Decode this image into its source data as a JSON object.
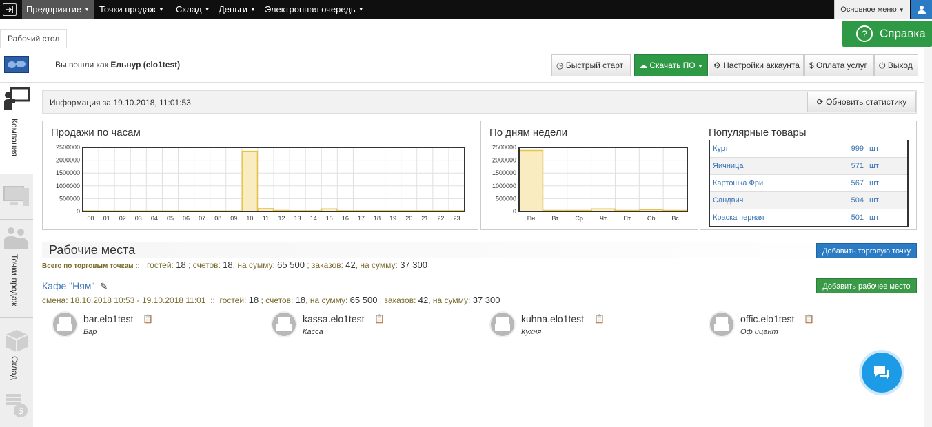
{
  "topnav": {
    "items": [
      {
        "label": "Предприятие"
      },
      {
        "label": "Точки продаж"
      },
      {
        "label": "Склад"
      },
      {
        "label": "Деньги"
      },
      {
        "label": "Электронная очередь"
      }
    ],
    "main_menu": "Основное меню"
  },
  "tabs": {
    "desk": "Рабочий стол"
  },
  "help": {
    "label": "Справка"
  },
  "header": {
    "logged_prefix": "Вы вошли как",
    "user": "Ельнур (elo1test)",
    "buttons": {
      "quickstart": "Быстрый старт",
      "download": "Скачать ПО",
      "settings": "Настройки аккаунта",
      "payment": "Оплата услуг",
      "exit": "Выход"
    }
  },
  "sidebar": {
    "items": [
      "Компания",
      "",
      "Точки продаж",
      "Склад",
      ""
    ]
  },
  "info": {
    "text": "Информация за 19.10.2018, 11:01:53",
    "refresh": "Обновить статистику"
  },
  "colors": {
    "bar_fill": "#f9ecc0",
    "bar_stroke": "#e8c24a",
    "accent_blue": "#2a7bc3",
    "accent_green": "#2e9a45"
  },
  "chart_data": [
    {
      "type": "bar",
      "title": "Продажи по часам",
      "categories": [
        "00",
        "01",
        "02",
        "03",
        "04",
        "05",
        "06",
        "07",
        "08",
        "09",
        "10",
        "11",
        "12",
        "13",
        "14",
        "15",
        "16",
        "17",
        "18",
        "19",
        "20",
        "21",
        "22",
        "23"
      ],
      "values": [
        25000,
        20000,
        20000,
        20000,
        20000,
        20000,
        20000,
        20000,
        20000,
        20000,
        2350000,
        110000,
        40000,
        30000,
        30000,
        100000,
        30000,
        30000,
        30000,
        30000,
        30000,
        30000,
        30000,
        30000
      ],
      "ylim": [
        0,
        2500000
      ],
      "yticks": [
        "2500000",
        "2000000",
        "1500000",
        "1000000",
        "500000",
        "0"
      ]
    },
    {
      "type": "bar",
      "title": "По дням недели",
      "categories": [
        "Пн",
        "Вт",
        "Ср",
        "Чт",
        "Пт",
        "Сб",
        "Вс"
      ],
      "values": [
        2380000,
        40000,
        40000,
        100000,
        40000,
        70000,
        40000
      ],
      "ylim": [
        0,
        2500000
      ],
      "yticks": [
        "2500000",
        "2000000",
        "1500000",
        "1000000",
        "500000",
        "0"
      ]
    }
  ],
  "popular": {
    "title": "Популярные товары",
    "rows": [
      {
        "name": "Курт",
        "qty": "999",
        "unit": "шт"
      },
      {
        "name": "Яичница",
        "qty": "571",
        "unit": "шт"
      },
      {
        "name": "Картошка Фри",
        "qty": "567",
        "unit": "шт"
      },
      {
        "name": "Сандвич",
        "qty": "504",
        "unit": "шт"
      },
      {
        "name": "Краска черная",
        "qty": "501",
        "unit": "шт"
      }
    ]
  },
  "workplaces": {
    "title": "Рабочие места",
    "add_point": "Добавить торговую точку",
    "totals_label": "Всего по торговым точкам ::",
    "guests_label": "гостей:",
    "guests": "18",
    "checks_label": "; счетов:",
    "checks": "18",
    "sum_label": ", на сумму:",
    "sum": "65 500",
    "orders_label": "; заказов:",
    "orders": "42",
    "orders_sum_label": ", на сумму:",
    "orders_sum": "37 300",
    "cafe": "Кафе \"Ням\"",
    "add_workplace": "Добавить рабочее место",
    "shift": "смена: 18.10.2018 10:53 - 19.10.2018 11:01",
    "shift_sep": "::",
    "items": [
      {
        "name": "bar.elo1test",
        "role": "Бар"
      },
      {
        "name": "kassa.elo1test",
        "role": "Касса"
      },
      {
        "name": "kuhna.elo1test",
        "role": "Кухня"
      },
      {
        "name": "offic.elo1test",
        "role": "Оф ицант"
      }
    ]
  }
}
